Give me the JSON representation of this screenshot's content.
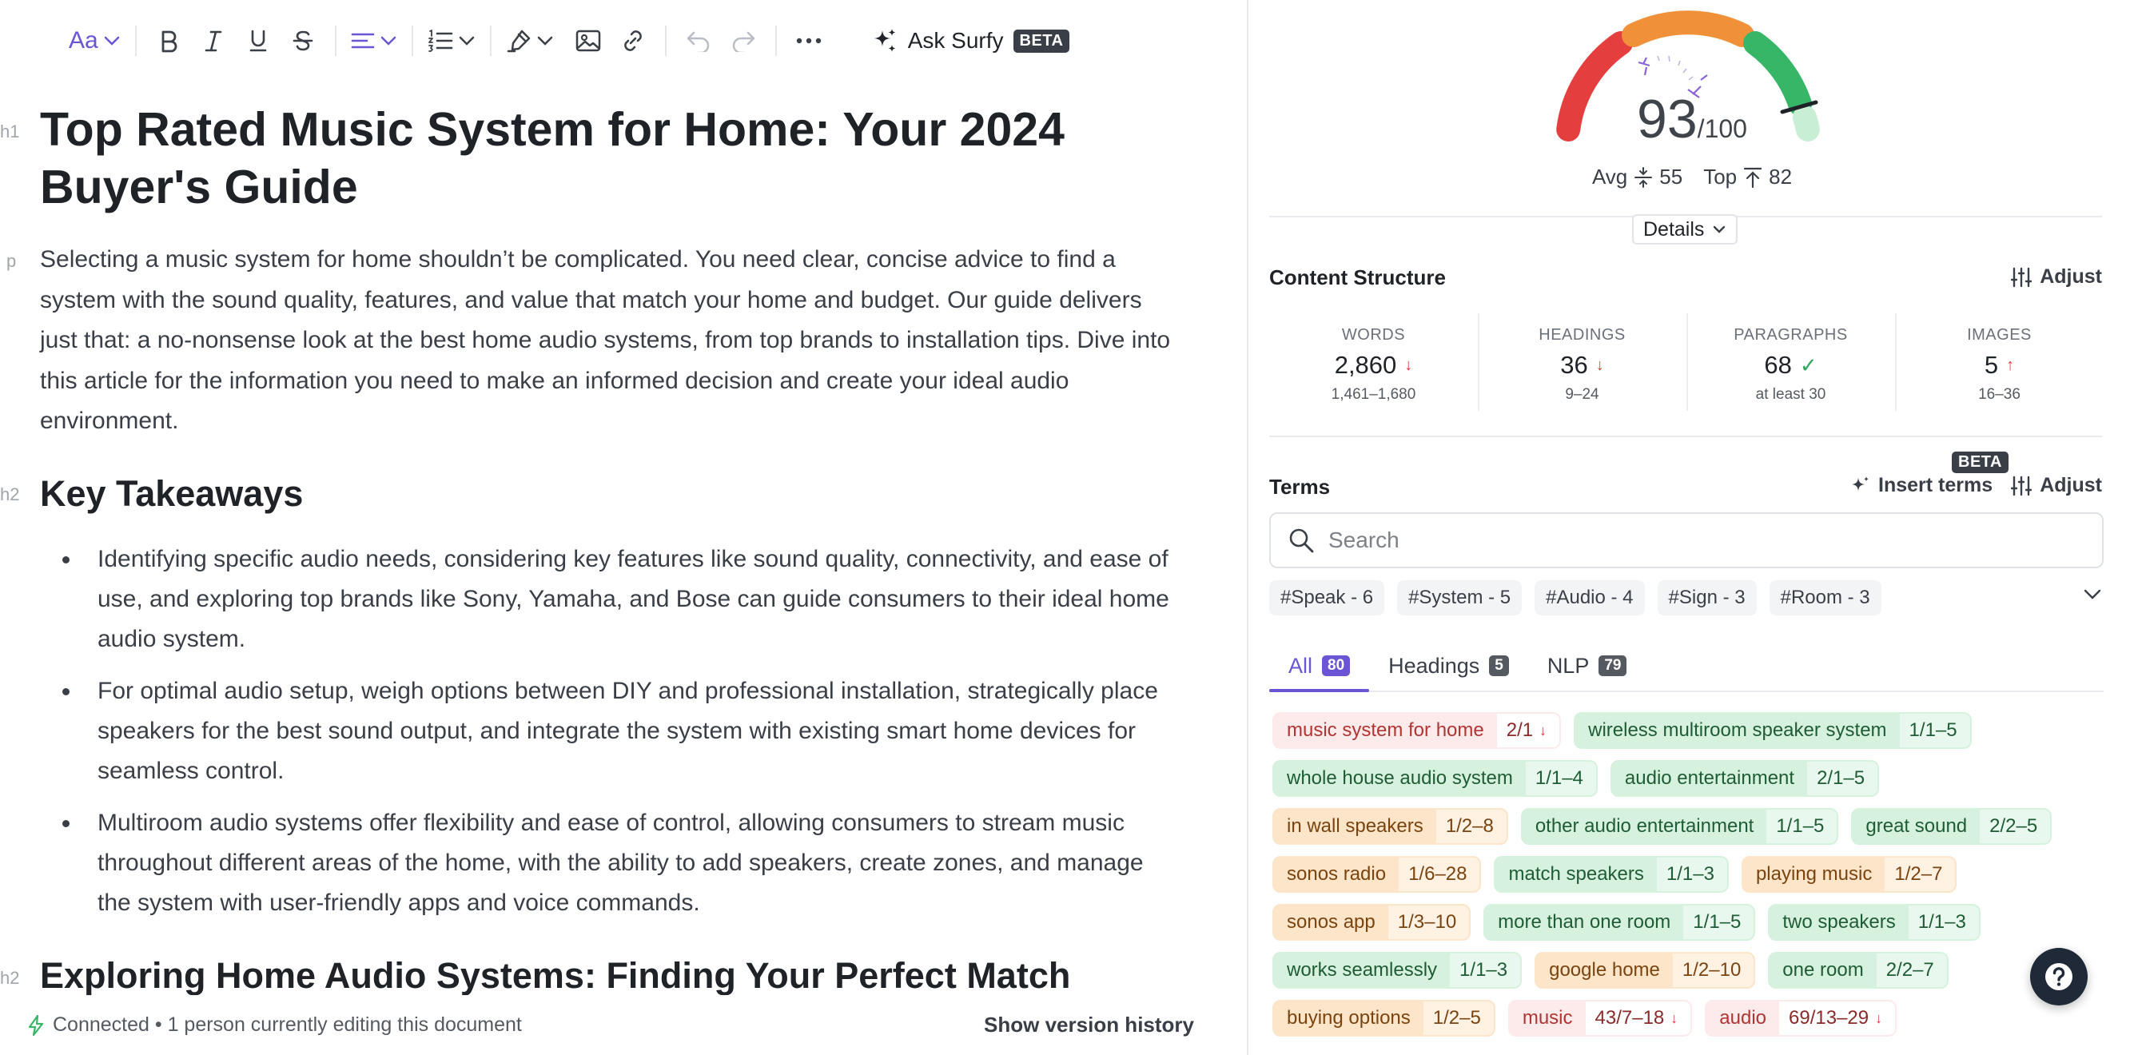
{
  "toolbar": {
    "font_label": "Aa",
    "ask_label": "Ask Surfy",
    "ask_badge": "BETA"
  },
  "document": {
    "title_tag": "h1",
    "title": "Top Rated Music System for Home: Your 2024 Buyer's Guide",
    "intro_tag": "p",
    "intro": "Selecting a music system for home shouldn’t be complicated. You need clear, concise advice to find a system with the sound quality, features, and value that match your home and budget. Our guide delivers just that: a no-nonsense look at the best home audio systems, from top brands to installation tips. Dive into this article for the information you need to make an informed decision and create your ideal audio environment.",
    "h2_tag": "h2",
    "h2_takeaways": "Key Takeaways",
    "takeaways": [
      "Identifying specific audio needs, considering key features like sound quality, connectivity, and ease of use, and exploring top brands like Sony, Yamaha, and Bose can guide consumers to their ideal home audio system.",
      "For optimal audio setup, weigh options between DIY and professional installation, strategically place speakers for the best sound output, and integrate the system with existing smart home devices for seamless control.",
      "Multiroom audio systems offer flexibility and ease of control, allowing consumers to stream music throughout different areas of the home, with the ability to add speakers, create zones, and manage the system with user-friendly apps and voice commands."
    ],
    "h2_exploring": "Exploring Home Audio Systems: Finding Your Perfect Match"
  },
  "status": {
    "connection": "Connected • 1 person currently editing this document",
    "version_history": "Show version history"
  },
  "score": {
    "value": "93",
    "max": "/100",
    "avg_label": "Avg",
    "avg_value": "55",
    "top_label": "Top",
    "top_value": "82",
    "details_label": "Details",
    "colors": {
      "red": "#e53e3e",
      "orange": "#f0913a",
      "green": "#37b668",
      "light_green": "#c8efd5",
      "marker": "#8a63d2"
    }
  },
  "content_structure": {
    "title": "Content Structure",
    "adjust_label": "Adjust",
    "metrics": [
      {
        "label": "WORDS",
        "value": "2,860",
        "status": "down",
        "range": "1,461–1,680"
      },
      {
        "label": "HEADINGS",
        "value": "36",
        "status": "down",
        "range": "9–24"
      },
      {
        "label": "PARAGRAPHS",
        "value": "68",
        "status": "ok",
        "range": "at least 30"
      },
      {
        "label": "IMAGES",
        "value": "5",
        "status": "up",
        "range": "16–36"
      }
    ]
  },
  "terms": {
    "title": "Terms",
    "insert_label": "Insert terms",
    "insert_badge": "BETA",
    "adjust_label": "Adjust",
    "search_placeholder": "Search",
    "topics": [
      "#Speak - 6",
      "#System - 5",
      "#Audio - 4",
      "#Sign - 3",
      "#Room - 3"
    ],
    "tabs": [
      {
        "label": "All",
        "count": "80",
        "active": true
      },
      {
        "label": "Headings",
        "count": "5",
        "active": false
      },
      {
        "label": "NLP",
        "count": "79",
        "active": false
      }
    ],
    "items": [
      {
        "term": "music system for home",
        "count": "2/1",
        "status": "red",
        "arrow": "down"
      },
      {
        "term": "wireless multiroom speaker system",
        "count": "1/1–5",
        "status": "green"
      },
      {
        "term": "whole house audio system",
        "count": "1/1–4",
        "status": "green"
      },
      {
        "term": "audio entertainment",
        "count": "2/1–5",
        "status": "green"
      },
      {
        "term": "in wall speakers",
        "count": "1/2–8",
        "status": "orange"
      },
      {
        "term": "other audio entertainment",
        "count": "1/1–5",
        "status": "green"
      },
      {
        "term": "great sound",
        "count": "2/2–5",
        "status": "green"
      },
      {
        "term": "sonos radio",
        "count": "1/6–28",
        "status": "orange"
      },
      {
        "term": "match speakers",
        "count": "1/1–3",
        "status": "green"
      },
      {
        "term": "playing music",
        "count": "1/2–7",
        "status": "orange"
      },
      {
        "term": "sonos app",
        "count": "1/3–10",
        "status": "orange"
      },
      {
        "term": "more than one room",
        "count": "1/1–5",
        "status": "green"
      },
      {
        "term": "two speakers",
        "count": "1/1–3",
        "status": "green"
      },
      {
        "term": "works seamlessly",
        "count": "1/1–3",
        "status": "green"
      },
      {
        "term": "google home",
        "count": "1/2–10",
        "status": "orange"
      },
      {
        "term": "one room",
        "count": "2/2–7",
        "status": "green"
      },
      {
        "term": "buying options",
        "count": "1/2–5",
        "status": "orange"
      },
      {
        "term": "music",
        "count": "43/7–18",
        "status": "red",
        "arrow": "down"
      },
      {
        "term": "audio",
        "count": "69/13–29",
        "status": "red",
        "arrow": "down"
      }
    ]
  }
}
